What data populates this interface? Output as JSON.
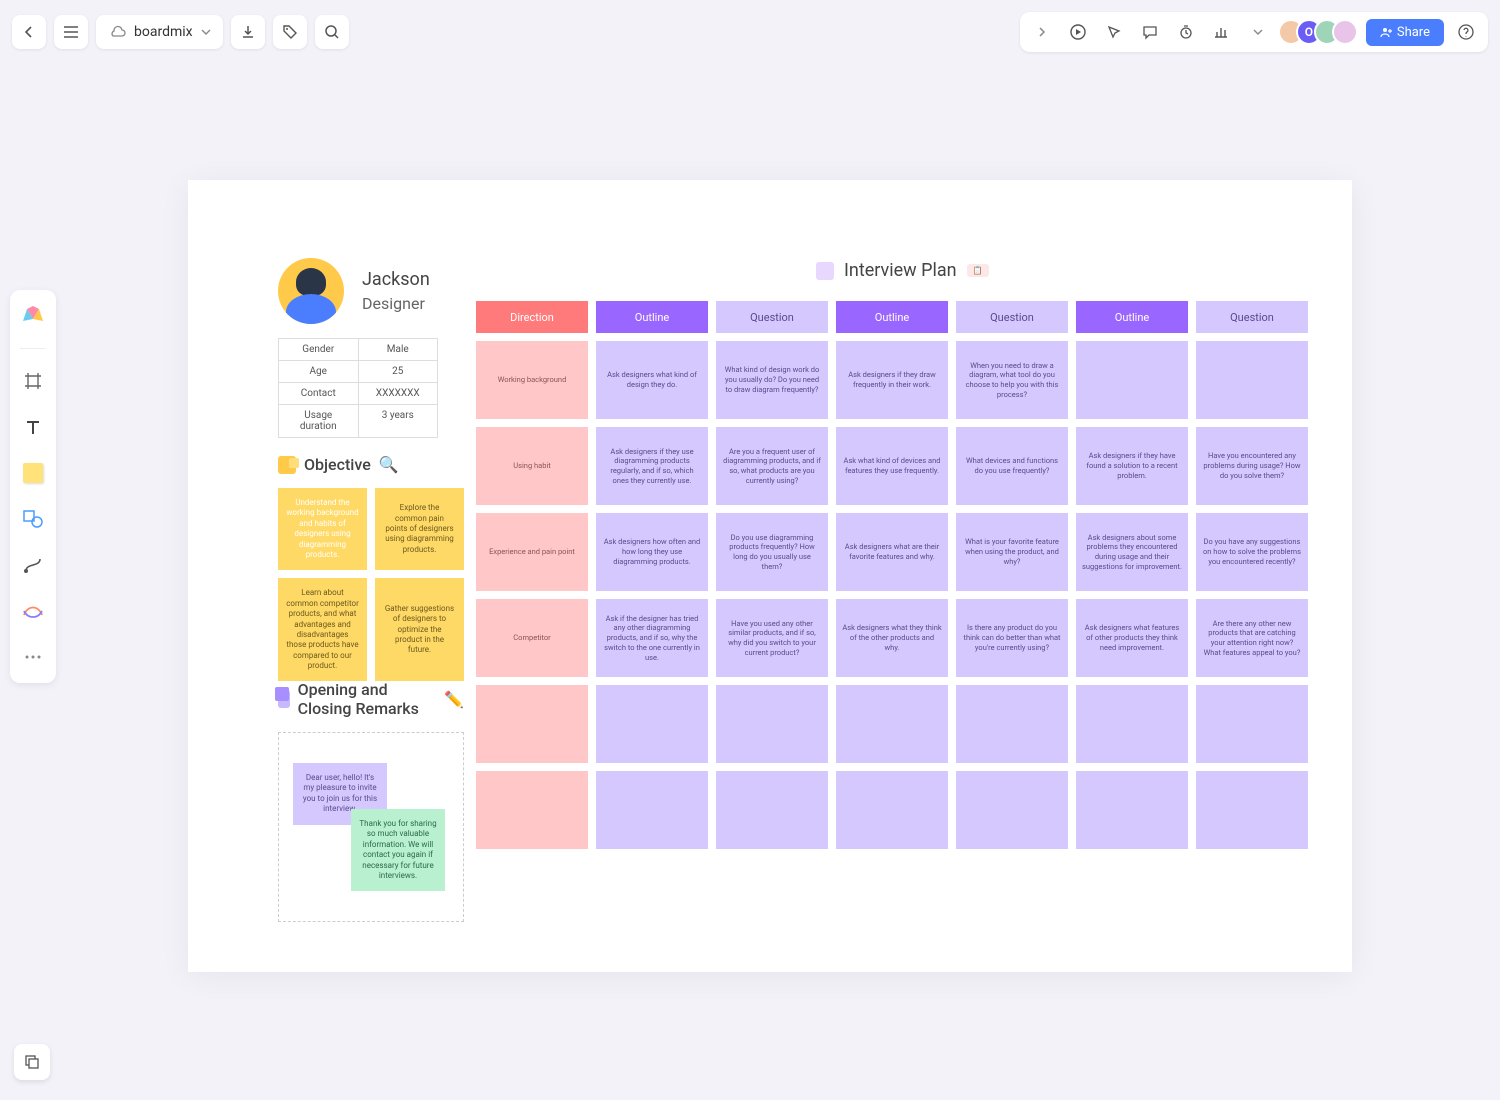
{
  "topbar": {
    "title": "boardmix",
    "share": "Share"
  },
  "profile": {
    "name": "Jackson",
    "role": "Designer",
    "rows": [
      {
        "k": "Gender",
        "v": "Male"
      },
      {
        "k": "Age",
        "v": "25"
      },
      {
        "k": "Contact",
        "v": "XXXXXXX"
      },
      {
        "k": "Usage duration",
        "v": "3 years"
      }
    ]
  },
  "objective": {
    "title": "Objective",
    "notes": [
      "Understand the working background and habits of designers using diagramming products.",
      "Explore the common pain points of designers using diagramming products.",
      "Learn about common competitor products, and what advantages and disadvantages those products have compared to our product.",
      "Gather suggestions of designers to optimize the product in the future."
    ]
  },
  "remarks": {
    "title": "Opening and Closing Remarks",
    "note1": "Dear user, hello! It's my pleasure to invite you to join us for this interview.",
    "note2": "Thank you for sharing so much valuable information. We will contact you again if necessary for future interviews."
  },
  "plan": {
    "title": "Interview Plan",
    "headers": [
      "Direction",
      "Outline",
      "Question",
      "Outline",
      "Question",
      "Outline",
      "Question"
    ],
    "rows": [
      [
        "Working background",
        "Ask designers what kind of design they do.",
        "What kind of design work do you usually do? Do you need to draw diagram frequently?",
        "Ask designers if they draw frequently in their work.",
        "When you need to draw a diagram, what tool do you choose to help you with this process?",
        "",
        ""
      ],
      [
        "Using habit",
        "Ask designers if they use diagramming products regularly, and if so, which ones they currently use.",
        "Are you a frequent user of diagramming products, and if so, what products are you currently using?",
        "Ask what kind of devices and features they use frequently.",
        "What devices and functions do you use frequently?",
        "Ask designers if they have found a solution to a recent problem.",
        "Have you encountered any problems during usage? How do you solve them?"
      ],
      [
        "Experience and pain point",
        "Ask designers how often and how long they use diagramming products.",
        "Do you use diagramming products frequently? How long do you usually use them?",
        "Ask designers what are their favorite features and why.",
        "What is your favorite feature when using the product, and why?",
        "Ask designers about some problems they encountered during usage and their suggestions for improvement.",
        "Do you have any suggestions on how to solve the problems you encountered recently?"
      ],
      [
        "Competitor",
        "Ask if the designer has tried any other diagramming products, and if so, why the switch to the one currently in use.",
        "Have you used any other similar products, and if so, why did you switch to your current product?",
        "Ask designers what they think of the other products and why.",
        "Is there any product do you think can do better than what you're currently using?",
        "Ask designers what features of other products they think need improvement.",
        "Are there any other new products that are catching your attention right now? What features appeal to you?"
      ],
      [
        "",
        "",
        "",
        "",
        "",
        "",
        ""
      ],
      [
        "",
        "",
        "",
        "",
        "",
        "",
        ""
      ]
    ]
  }
}
